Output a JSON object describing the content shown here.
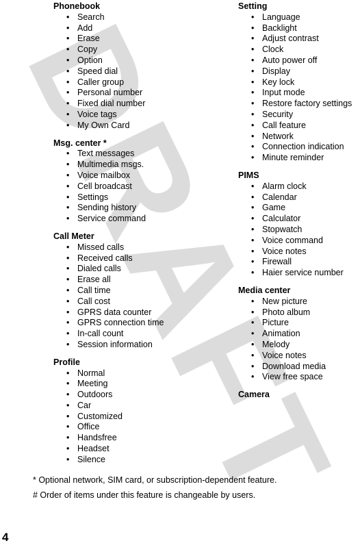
{
  "document": {
    "page_number": "4",
    "watermark_text": "DRAFT",
    "watermark_color": "#dcdcdc",
    "text_color": "#000000",
    "background_color": "#ffffff",
    "bullet_glyph": "•"
  },
  "left_column": {
    "sections": [
      {
        "heading": "Phonebook",
        "items": [
          "Search",
          "Add",
          "Erase",
          "Copy",
          "Option",
          "Speed dial",
          "Caller group",
          "Personal number",
          "Fixed dial number",
          "Voice tags",
          "My Own Card"
        ]
      },
      {
        "heading": "Msg. center *",
        "items": [
          "Text messages",
          "Multimedia msgs.",
          "Voice mailbox",
          "Cell broadcast",
          "Settings",
          "Sending history",
          "Service command"
        ]
      },
      {
        "heading": "Call Meter",
        "items": [
          "Missed calls",
          "Received calls",
          "Dialed calls",
          "Erase all",
          "Call time",
          "Call cost",
          "GPRS data counter",
          "GPRS connection time",
          "In-call count",
          "Session information"
        ]
      },
      {
        "heading": "Profile",
        "items": [
          "Normal",
          "Meeting",
          "Outdoors",
          "Car",
          "Customized",
          "Office",
          "Handsfree",
          "Headset",
          "Silence"
        ]
      }
    ]
  },
  "right_column": {
    "sections": [
      {
        "heading": "Setting",
        "items": [
          "Language",
          "Backlight",
          "Adjust contrast",
          "Clock",
          "Auto power off",
          "Display",
          "Key lock",
          "Input mode",
          "Restore factory settings",
          "Security",
          "Call feature",
          "Network",
          "Connection indication",
          "Minute reminder"
        ]
      },
      {
        "heading": "PIMS",
        "items": [
          "Alarm clock",
          "Calendar",
          "Game",
          "Calculator",
          "Stopwatch",
          "Voice command",
          "Voice notes",
          "Firewall",
          "Haier service number"
        ]
      },
      {
        "heading": "Media center",
        "items": [
          "New picture",
          "Photo album",
          "Picture",
          "Animation",
          "Melody",
          "Voice notes",
          "Download media",
          "View free space"
        ]
      },
      {
        "heading": "Camera",
        "items": []
      }
    ]
  },
  "footnotes": [
    "* Optional network, SIM card, or subscription-dependent feature.",
    "# Order of items under this feature is changeable by users."
  ]
}
